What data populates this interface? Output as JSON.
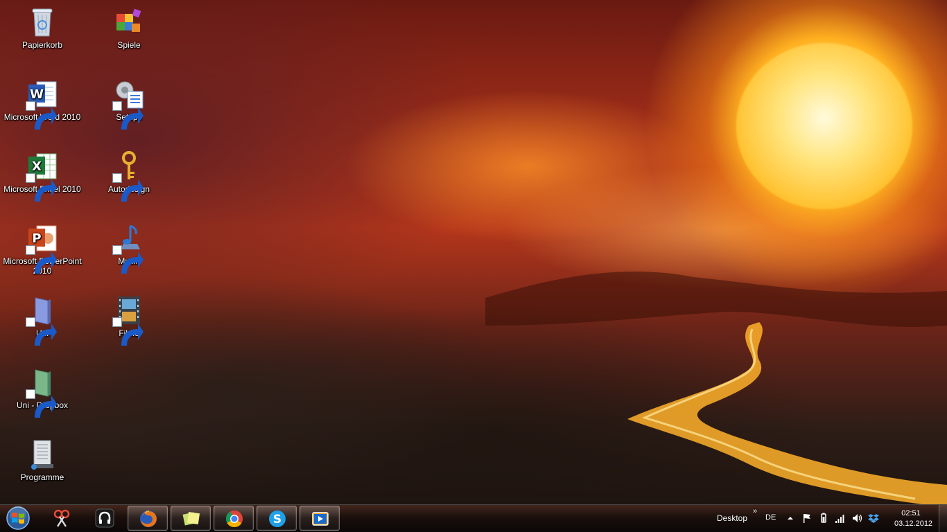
{
  "desktop": {
    "icons": [
      {
        "label": "Papierkorb",
        "icon": "recycle-bin-icon"
      },
      {
        "label": "Spiele",
        "icon": "games-folder-icon"
      },
      {
        "label": "Microsoft Word 2010",
        "icon": "word-icon"
      },
      {
        "label": "Setups",
        "icon": "setups-icon"
      },
      {
        "label": "Microsoft Excel 2010",
        "icon": "excel-icon"
      },
      {
        "label": "Autodesign",
        "icon": "key-icon"
      },
      {
        "label": "Microsoft PowerPoint 2010",
        "icon": "powerpoint-icon"
      },
      {
        "label": "Musik",
        "icon": "music-note-icon"
      },
      {
        "label": "Uni",
        "icon": "folder-icon"
      },
      {
        "label": "Filme",
        "icon": "film-icon"
      },
      {
        "label": "Uni - Dropbox",
        "icon": "folder-icon"
      },
      {
        "label": "Programme",
        "icon": "programs-icon"
      }
    ]
  },
  "taskbar": {
    "start_icon": "windows-start-icon",
    "pinned": [
      {
        "icon": "snipping-tool-icon"
      },
      {
        "icon": "headphones-app-icon"
      },
      {
        "icon": "firefox-icon"
      },
      {
        "icon": "sticky-notes-icon"
      },
      {
        "icon": "chrome-icon"
      },
      {
        "icon": "skype-icon"
      },
      {
        "icon": "media-player-icon"
      }
    ],
    "desktop_toolbar_label": "Desktop",
    "toolbar_chevron": "»",
    "language": "DE",
    "tray_icons": [
      "tray-expand-icon",
      "action-center-flag-icon",
      "power-icon",
      "network-signal-icon",
      "volume-icon",
      "dropbox-icon"
    ],
    "clock": {
      "time": "02:51",
      "date": "03.12.2012"
    }
  },
  "colors": {
    "sun": "#ffd45a",
    "sky": "#b5361b",
    "taskbar": "#140c0a"
  }
}
